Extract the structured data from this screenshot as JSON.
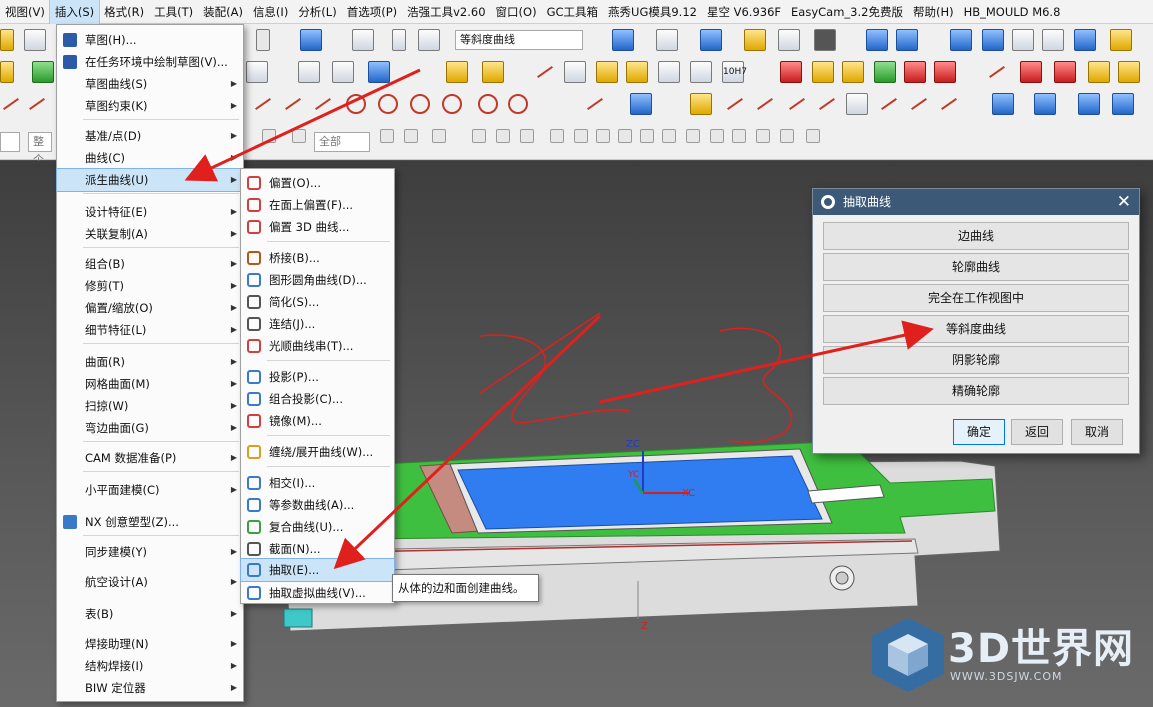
{
  "menubar": [
    "视图(V)",
    "插入(S)",
    "格式(R)",
    "工具(T)",
    "装配(A)",
    "信息(I)",
    "分析(L)",
    "首选项(P)",
    "浩强工具v2.60",
    "窗口(O)",
    "GC工具箱",
    "燕秀UG模具9.12",
    "星空 V6.936F",
    "EasyCam_3.2免费版",
    "帮助(H)",
    "HB_MOULD M6.8"
  ],
  "toolbar": {
    "curve_type_combo": "等斜度曲线",
    "filter_combo": "整个",
    "selection_combo": "全部",
    "tolerance_label": "10H7"
  },
  "insert_menu": [
    {
      "label": "草图(H)...",
      "arrow": false
    },
    {
      "label": "在任务环境中绘制草图(V)...",
      "arrow": false
    },
    {
      "label": "草图曲线(S)",
      "arrow": true
    },
    {
      "label": "草图约束(K)",
      "arrow": true
    },
    {
      "label": "基准/点(D)",
      "arrow": true
    },
    {
      "label": "曲线(C)",
      "arrow": true
    },
    {
      "label": "派生曲线(U)",
      "arrow": true
    },
    {
      "label": "设计特征(E)",
      "arrow": true
    },
    {
      "label": "关联复制(A)",
      "arrow": true
    },
    {
      "label": "组合(B)",
      "arrow": true
    },
    {
      "label": "修剪(T)",
      "arrow": true
    },
    {
      "label": "偏置/缩放(O)",
      "arrow": true
    },
    {
      "label": "细节特征(L)",
      "arrow": true
    },
    {
      "label": "曲面(R)",
      "arrow": true
    },
    {
      "label": "网格曲面(M)",
      "arrow": true
    },
    {
      "label": "扫掠(W)",
      "arrow": true
    },
    {
      "label": "弯边曲面(G)",
      "arrow": true
    },
    {
      "label": "CAM 数据准备(P)",
      "arrow": true
    },
    {
      "label": "小平面建模(C)",
      "arrow": true
    },
    {
      "label": "NX 创意塑型(Z)...",
      "arrow": false
    },
    {
      "label": "同步建模(Y)",
      "arrow": true
    },
    {
      "label": "航空设计(A)",
      "arrow": true
    },
    {
      "label": "表(B)",
      "arrow": true
    },
    {
      "label": "焊接助理(N)",
      "arrow": true
    },
    {
      "label": "结构焊接(I)",
      "arrow": true
    },
    {
      "label": "BIW 定位器",
      "arrow": true
    }
  ],
  "derived_submenu": [
    "偏置(O)...",
    "在面上偏置(F)...",
    "偏置 3D 曲线...",
    "桥接(B)...",
    "图形圆角曲线(D)...",
    "简化(S)...",
    "连结(J)...",
    "光顺曲线串(T)...",
    "投影(P)...",
    "组合投影(C)...",
    "镜像(M)...",
    "缠绕/展开曲线(W)...",
    "相交(I)...",
    "等参数曲线(A)...",
    "复合曲线(U)...",
    "截面(N)...",
    "抽取(E)...",
    "抽取虚拟曲线(V)..."
  ],
  "tooltip": "从体的边和面创建曲线。",
  "dialog": {
    "title": "抽取曲线",
    "options": [
      "边曲线",
      "轮廓曲线",
      "完全在工作视图中",
      "等斜度曲线",
      "阴影轮廓",
      "精确轮廓"
    ],
    "ok": "确定",
    "back": "返回",
    "cancel": "取消"
  },
  "axes": {
    "xc": "XC",
    "yc": "YC",
    "zc": "ZC",
    "z": "Z"
  },
  "watermark": {
    "brand": "3D世界网",
    "url": "WWW.3DSJW.COM"
  },
  "colors": {
    "menu_highlight": "#cce4f7",
    "dialog_title": "#3c5a78",
    "annotation_red": "#e0201c",
    "part_green": "#3fbf3f",
    "face_blue": "#2f7df0"
  }
}
